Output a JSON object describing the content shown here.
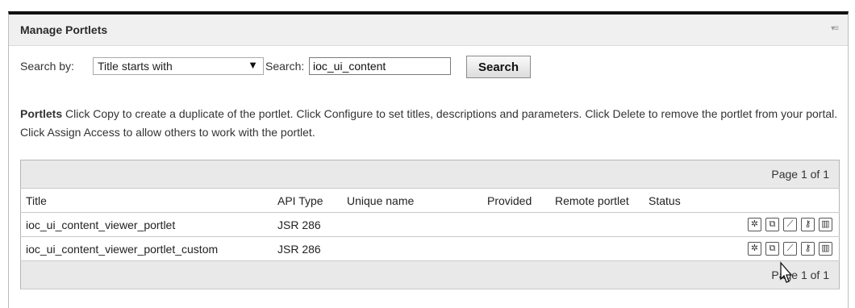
{
  "portlet": {
    "title": "Manage Portlets",
    "menu_icon": "menu-toggle-icon"
  },
  "search": {
    "by_label": "Search by:",
    "by_value": "Title starts with",
    "label": "Search:",
    "value": "ioc_ui_content",
    "button": "Search"
  },
  "description": {
    "heading": "Portlets",
    "text": "Click Copy to create a duplicate of the portlet. Click Configure to set titles, descriptions and parameters. Click Delete to remove the portlet from your portal. Click Assign Access to allow others to work with the portlet."
  },
  "table": {
    "pager_top": "Page 1 of 1",
    "pager_bottom": "Page 1 of 1",
    "columns": [
      "Title",
      "API Type",
      "Unique name",
      "Provided",
      "Remote portlet",
      "Status"
    ],
    "rows": [
      {
        "title": "ioc_ui_content_viewer_portlet",
        "api": "JSR 286",
        "unique": "",
        "provided": "",
        "remote": "",
        "status": ""
      },
      {
        "title": "ioc_ui_content_viewer_portlet_custom",
        "api": "JSR 286",
        "unique": "",
        "provided": "",
        "remote": "",
        "status": ""
      }
    ],
    "action_icons": [
      "settings-icon",
      "copy-icon",
      "configure-icon",
      "access-icon",
      "delete-icon"
    ]
  }
}
